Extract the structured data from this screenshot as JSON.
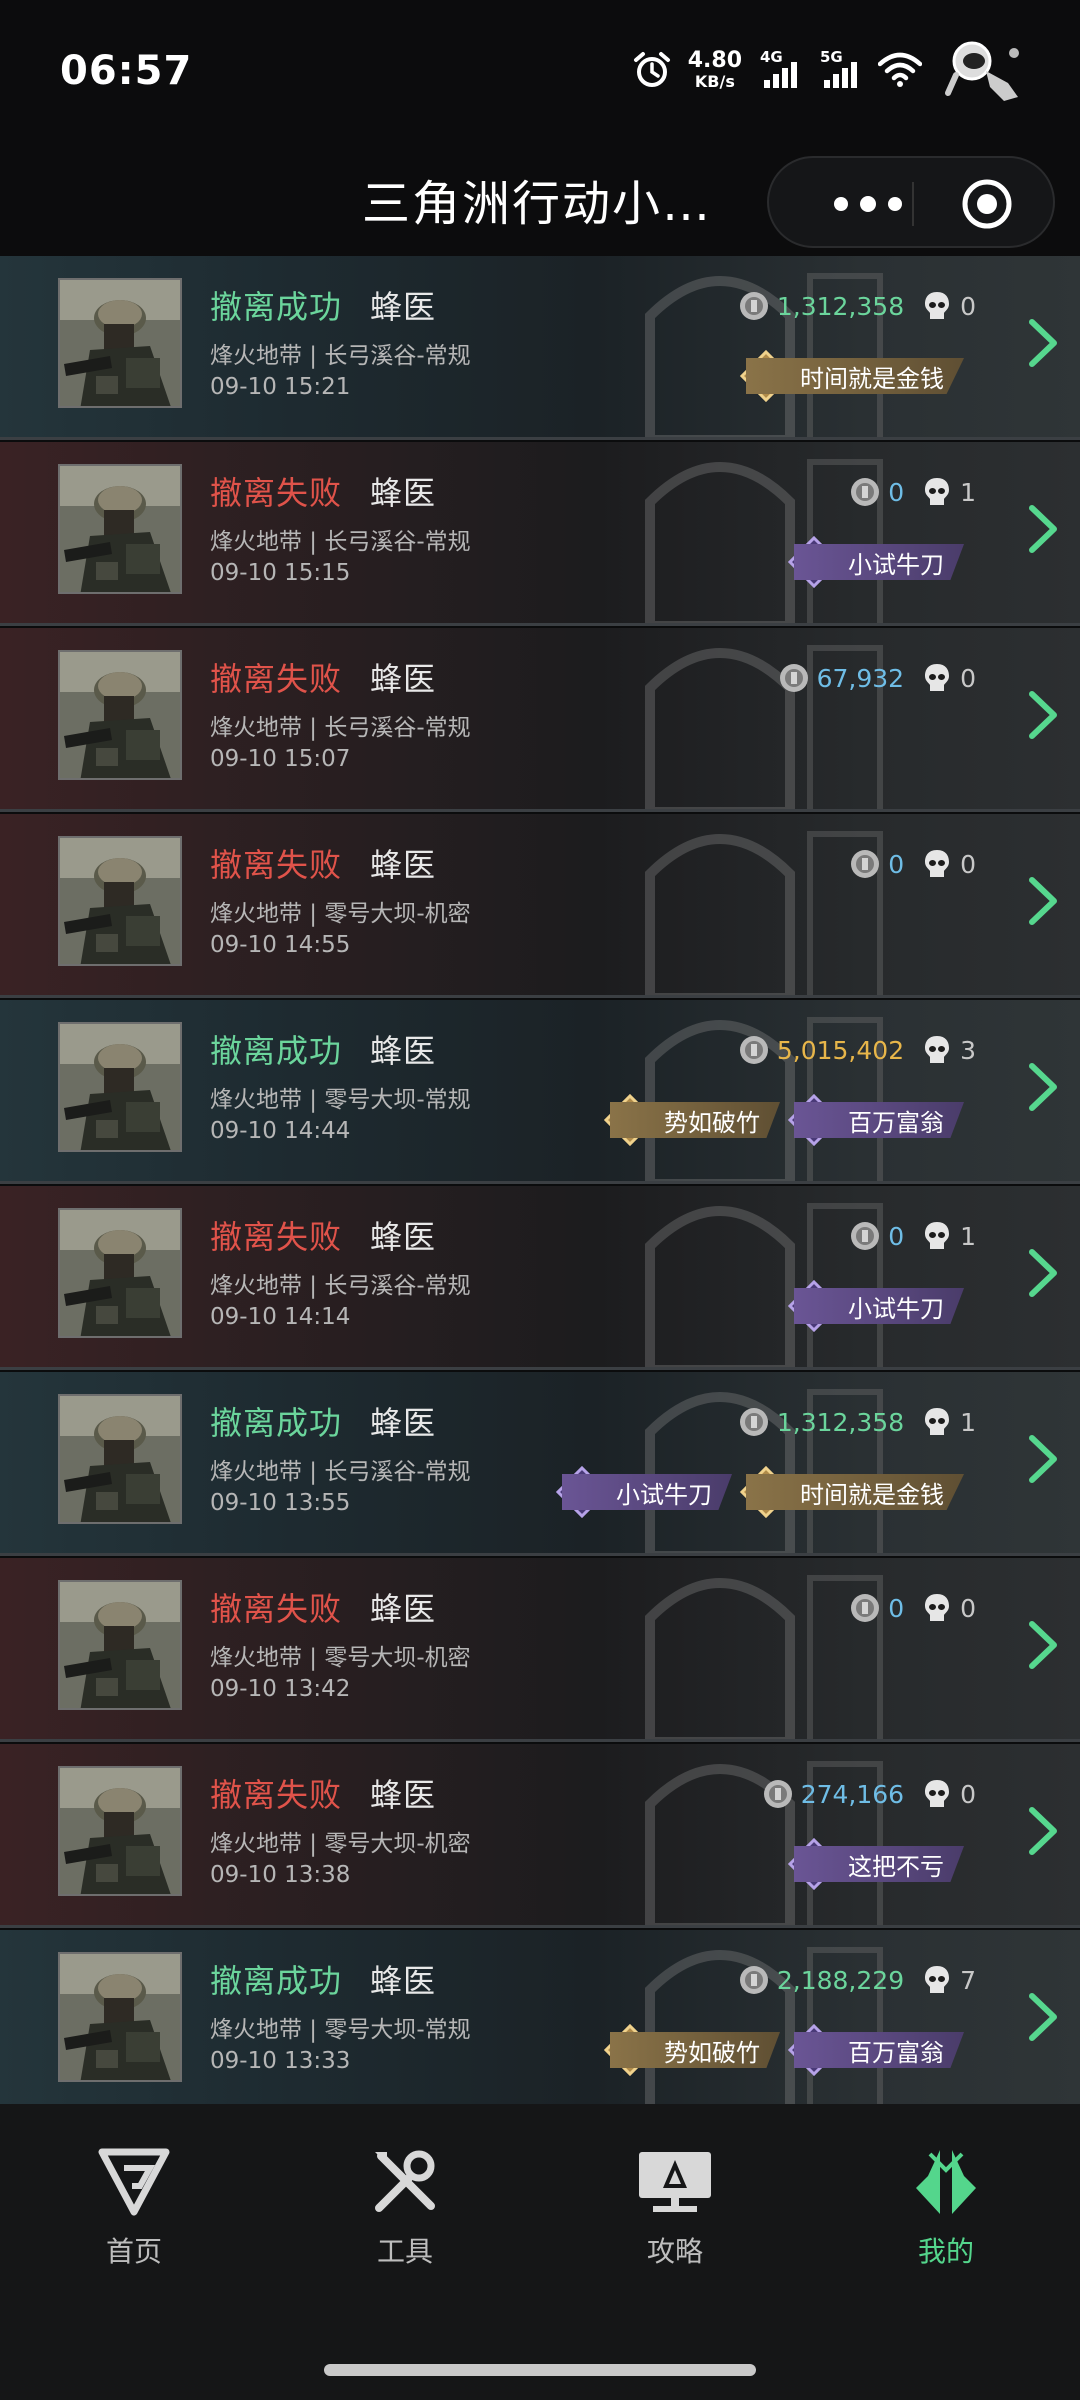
{
  "status_bar": {
    "time": "06:57",
    "net_speed_value": "4.80",
    "net_speed_unit": "KB/s",
    "sim1": "4G",
    "sim2": "5G"
  },
  "title_bar": {
    "title": "三角洲行动小…"
  },
  "records": [
    {
      "status": "撤离成功",
      "result": "success",
      "operator": "蜂医",
      "map": "烽火地带 | 长弓溪谷-常规",
      "time": "09-10 15:21",
      "value": "1,312,358",
      "value_color": "green",
      "kills": "0",
      "badges": [
        {
          "label": "时间就是金钱",
          "tier": "gold"
        }
      ]
    },
    {
      "status": "撤离失败",
      "result": "fail",
      "operator": "蜂医",
      "map": "烽火地带 | 长弓溪谷-常规",
      "time": "09-10 15:15",
      "value": "0",
      "value_color": "blue",
      "kills": "1",
      "badges": [
        {
          "label": "小试牛刀",
          "tier": "purple"
        }
      ]
    },
    {
      "status": "撤离失败",
      "result": "fail",
      "operator": "蜂医",
      "map": "烽火地带 | 长弓溪谷-常规",
      "time": "09-10 15:07",
      "value": "67,932",
      "value_color": "blue",
      "kills": "0",
      "badges": []
    },
    {
      "status": "撤离失败",
      "result": "fail",
      "operator": "蜂医",
      "map": "烽火地带 | 零号大坝-机密",
      "time": "09-10 14:55",
      "value": "0",
      "value_color": "blue",
      "kills": "0",
      "badges": []
    },
    {
      "status": "撤离成功",
      "result": "success",
      "operator": "蜂医",
      "map": "烽火地带 | 零号大坝-常规",
      "time": "09-10 14:44",
      "value": "5,015,402",
      "value_color": "gold",
      "kills": "3",
      "badges": [
        {
          "label": "势如破竹",
          "tier": "gold"
        },
        {
          "label": "百万富翁",
          "tier": "purple"
        }
      ]
    },
    {
      "status": "撤离失败",
      "result": "fail",
      "operator": "蜂医",
      "map": "烽火地带 | 长弓溪谷-常规",
      "time": "09-10 14:14",
      "value": "0",
      "value_color": "blue",
      "kills": "1",
      "badges": [
        {
          "label": "小试牛刀",
          "tier": "purple"
        }
      ]
    },
    {
      "status": "撤离成功",
      "result": "success",
      "operator": "蜂医",
      "map": "烽火地带 | 长弓溪谷-常规",
      "time": "09-10 13:55",
      "value": "1,312,358",
      "value_color": "green",
      "kills": "1",
      "badges": [
        {
          "label": "小试牛刀",
          "tier": "purple"
        },
        {
          "label": "时间就是金钱",
          "tier": "gold"
        }
      ]
    },
    {
      "status": "撤离失败",
      "result": "fail",
      "operator": "蜂医",
      "map": "烽火地带 | 零号大坝-机密",
      "time": "09-10 13:42",
      "value": "0",
      "value_color": "blue",
      "kills": "0",
      "badges": []
    },
    {
      "status": "撤离失败",
      "result": "fail",
      "operator": "蜂医",
      "map": "烽火地带 | 零号大坝-机密",
      "time": "09-10 13:38",
      "value": "274,166",
      "value_color": "blue",
      "kills": "0",
      "badges": [
        {
          "label": "这把不亏",
          "tier": "purple"
        }
      ]
    },
    {
      "status": "撤离成功",
      "result": "success",
      "operator": "蜂医",
      "map": "烽火地带 | 零号大坝-常规",
      "time": "09-10 13:33",
      "value": "2,188,229",
      "value_color": "green",
      "kills": "7",
      "badges": [
        {
          "label": "势如破竹",
          "tier": "gold"
        },
        {
          "label": "百万富翁",
          "tier": "purple"
        }
      ]
    }
  ],
  "tabbar": {
    "tabs": [
      {
        "label": "首页",
        "icon": "home-logo-icon",
        "active": false
      },
      {
        "label": "工具",
        "icon": "tools-icon",
        "active": false
      },
      {
        "label": "攻略",
        "icon": "guide-icon",
        "active": false
      },
      {
        "label": "我的",
        "icon": "profile-logo-icon",
        "active": true
      }
    ]
  },
  "colors": {
    "success": "#6bd59c",
    "fail": "#e0534a",
    "value_green": "#6bd59c",
    "value_blue": "#6fbde6",
    "value_gold": "#e8b64a",
    "accent": "#54d68c"
  }
}
